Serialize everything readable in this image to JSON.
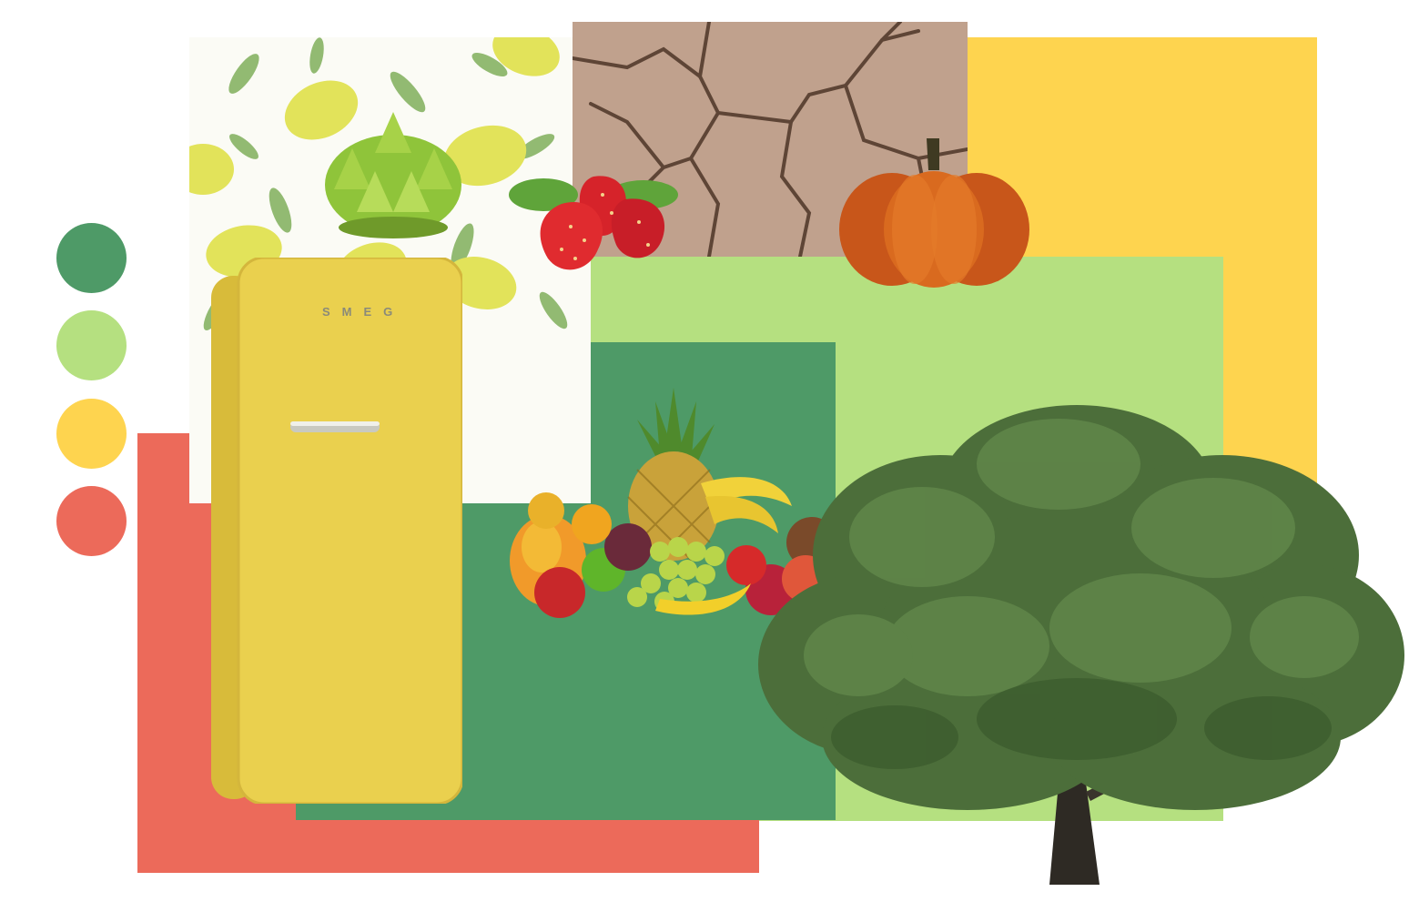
{
  "palette": {
    "swatches": [
      {
        "name": "dark-green",
        "color": "#4e9a67"
      },
      {
        "name": "light-green",
        "color": "#b5e080"
      },
      {
        "name": "yellow",
        "color": "#fed44f"
      },
      {
        "name": "coral",
        "color": "#ec6a5a"
      }
    ]
  },
  "blocks": {
    "coral": "#ec6a5a",
    "dark_green": "#4e9a67",
    "light_green": "#b5e080",
    "yellow": "#fed44f"
  },
  "images": [
    {
      "icon": "lemon-pattern-image"
    },
    {
      "icon": "cracked-earth-image"
    },
    {
      "icon": "romanesco-image"
    },
    {
      "icon": "strawberries-image"
    },
    {
      "icon": "pumpkin-image"
    },
    {
      "icon": "yellow-fridge-image"
    },
    {
      "icon": "fruit-pile-image"
    },
    {
      "icon": "tree-image"
    }
  ],
  "fridge": {
    "logo": "SMEG"
  }
}
